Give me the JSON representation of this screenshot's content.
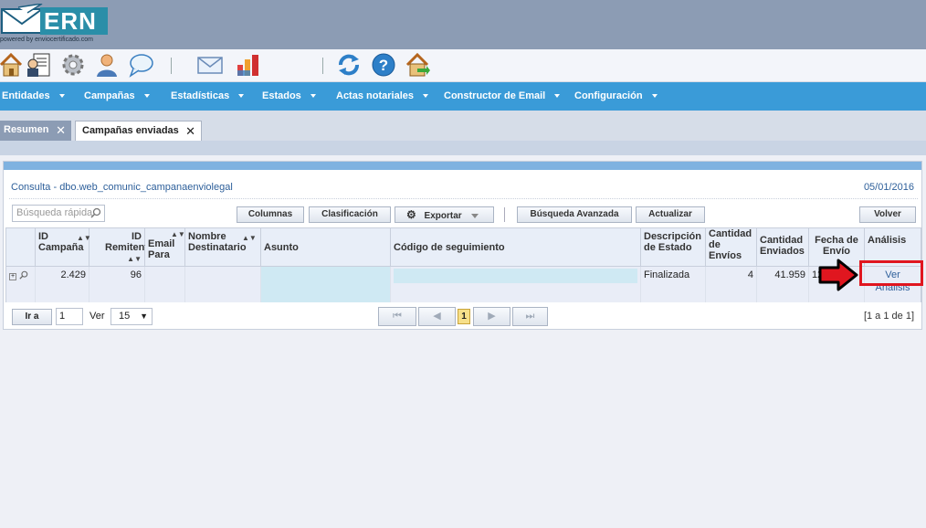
{
  "header": {
    "brand": "ERN",
    "powered_by": "powered by enviocertificado.com"
  },
  "toolbar": {
    "icons": [
      "home-icon",
      "reports-icon",
      "gear-icon",
      "user-icon",
      "chat-icon",
      "mail-icon",
      "chart-icon",
      "refresh-icon",
      "help-icon",
      "exit-icon"
    ]
  },
  "menu": {
    "items": [
      {
        "label": "Entidades"
      },
      {
        "label": "Campañas"
      },
      {
        "label": "Estadísticas"
      },
      {
        "label": "Estados"
      },
      {
        "label": "Actas notariales"
      },
      {
        "label": "Constructor de Email"
      },
      {
        "label": "Configuración"
      }
    ]
  },
  "tabs": [
    {
      "label": "Resumen",
      "active": false
    },
    {
      "label": "Campañas enviadas",
      "active": true
    }
  ],
  "panel": {
    "title": "Consulta - dbo.web_comunic_campanaenviolegal",
    "date": "05/01/2016",
    "search_placeholder": "Búsqueda rápida",
    "buttons": {
      "columns": "Columnas",
      "classification": "Clasificación",
      "export": "Exportar",
      "advanced_search": "Búsqueda Avanzada",
      "refresh": "Actualizar",
      "back": "Volver"
    }
  },
  "grid": {
    "columns": [
      {
        "label": "ID Campaña"
      },
      {
        "label": "ID Remitente"
      },
      {
        "label": "Email Para"
      },
      {
        "label": "Nombre Destinatario"
      },
      {
        "label": "Asunto"
      },
      {
        "label": "Código de seguimiento"
      },
      {
        "label": "Descripción de Estado"
      },
      {
        "label": "Cantidad de Envíos"
      },
      {
        "label": "Cantidad Enviados"
      },
      {
        "label": "Fecha de Envío"
      },
      {
        "label": "Análisis"
      }
    ],
    "rows": [
      {
        "id_campana": "2.429",
        "id_remitente": "96",
        "email_para": "",
        "nombre_destinatario": "",
        "asunto": "",
        "codigo_seguimiento": "",
        "descripcion_estado": "Finalizada",
        "cantidad_envios": "4",
        "cantidad_enviados": "41.959",
        "fecha_envio": "12",
        "analisis": "Ver Análisis"
      }
    ]
  },
  "pager": {
    "go_label": "Ir a",
    "page_input": "1",
    "view_label": "Ver",
    "page_size": "15",
    "current_page": "1",
    "summary": "[1 a 1 de 1]"
  },
  "colors": {
    "menubar": "#3a9bd8",
    "header": "#8c9cb4",
    "highlight": "#e0161f"
  }
}
